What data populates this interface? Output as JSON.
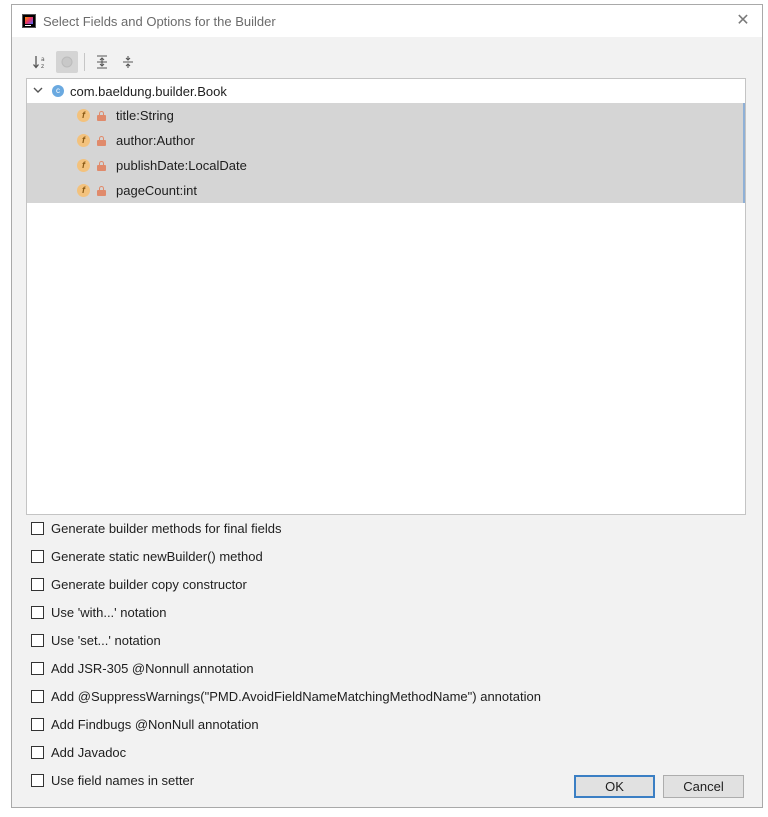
{
  "window": {
    "title": "Select Fields and Options for the Builder",
    "close_glyph": "✕"
  },
  "toolbar": {
    "items": [
      {
        "name": "sort-alphabetically-icon",
        "glyph": "↓ᵃz",
        "pressed": false
      },
      {
        "name": "show-inherited-icon",
        "glyph": "",
        "pressed": true
      },
      {
        "name": "expand-all-icon",
        "glyph": "⇳",
        "pressed": false
      },
      {
        "name": "collapse-all-icon",
        "glyph": "÷",
        "pressed": false
      }
    ]
  },
  "tree": {
    "root": {
      "label": "com.baeldung.builder.Book",
      "icon": "class-icon",
      "icon_letter": "c",
      "expanded": true
    },
    "fields": [
      {
        "label": "title:String",
        "icon_letter": "f",
        "selected": true
      },
      {
        "label": "author:Author",
        "icon_letter": "f",
        "selected": true
      },
      {
        "label": "publishDate:LocalDate",
        "icon_letter": "f",
        "selected": true
      },
      {
        "label": "pageCount:int",
        "icon_letter": "f",
        "selected": true
      }
    ]
  },
  "options": [
    {
      "label": "Generate builder methods for final fields",
      "checked": false
    },
    {
      "label": "Generate static newBuilder() method",
      "checked": false
    },
    {
      "label": "Generate builder copy constructor",
      "checked": false
    },
    {
      "label": "Use 'with...' notation",
      "checked": false
    },
    {
      "label": "Use 'set...' notation",
      "checked": false
    },
    {
      "label": "Add JSR-305 @Nonnull annotation",
      "checked": false
    },
    {
      "label": "Add @SuppressWarnings(\"PMD.AvoidFieldNameMatchingMethodName\") annotation",
      "checked": false
    },
    {
      "label": "Add Findbugs @NonNull annotation",
      "checked": false
    },
    {
      "label": "Add Javadoc",
      "checked": false
    },
    {
      "label": "Use field names in setter",
      "checked": false
    }
  ],
  "buttons": {
    "ok_label": "OK",
    "cancel_label": "Cancel"
  },
  "colors": {
    "selection": "#d5d5d5",
    "accent": "#3b7fc4",
    "field_icon": "#f3c27d",
    "class_icon": "#6aa9e0"
  }
}
